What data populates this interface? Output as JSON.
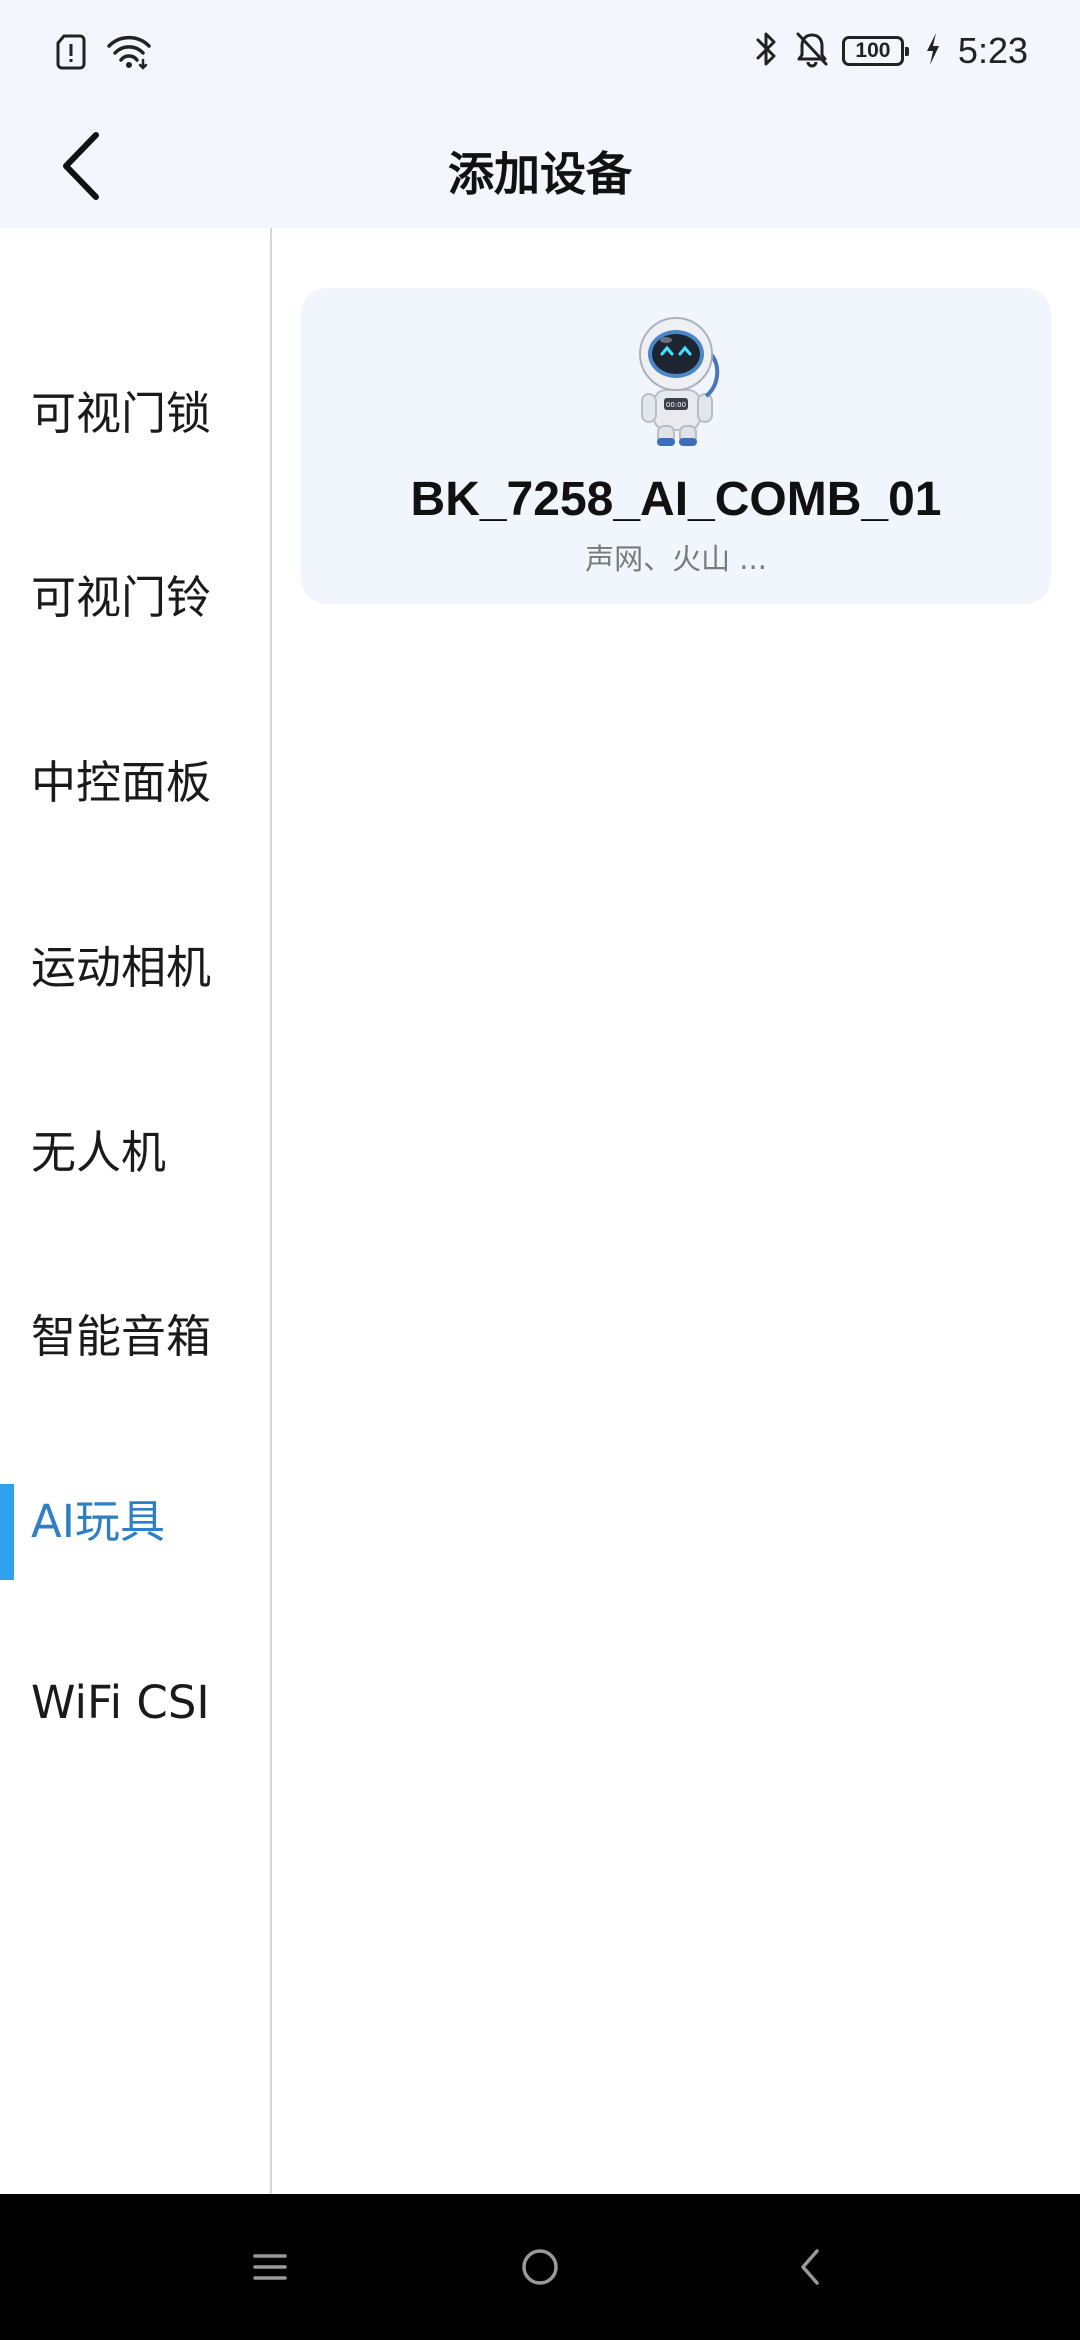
{
  "status_bar": {
    "time": "5:23",
    "battery": "100",
    "icons": [
      "sim-alert-icon",
      "wifi-icon",
      "bluetooth-icon",
      "bell-off-icon",
      "battery-icon",
      "charging-icon"
    ]
  },
  "header": {
    "title": "添加设备",
    "back_icon": "chevron-left-icon"
  },
  "sidebar": {
    "active_color": "#2f7fc4",
    "indicator_color": "#2fa2ee",
    "items": [
      {
        "label": "可视门锁"
      },
      {
        "label": "可视门铃"
      },
      {
        "label": "中控面板"
      },
      {
        "label": "运动相机"
      },
      {
        "label": "无人机"
      },
      {
        "label": "智能音箱"
      },
      {
        "label": "AI玩具",
        "active": true
      },
      {
        "label": "WiFi CSI"
      }
    ]
  },
  "devices": [
    {
      "name": "BK_7258_AI_COMB_01",
      "subtitle": "声网、火山 ...",
      "image": "astronaut-robot-toy"
    }
  ],
  "nav_bar": {
    "buttons": [
      "menu-icon",
      "home-icon",
      "back-icon"
    ]
  }
}
